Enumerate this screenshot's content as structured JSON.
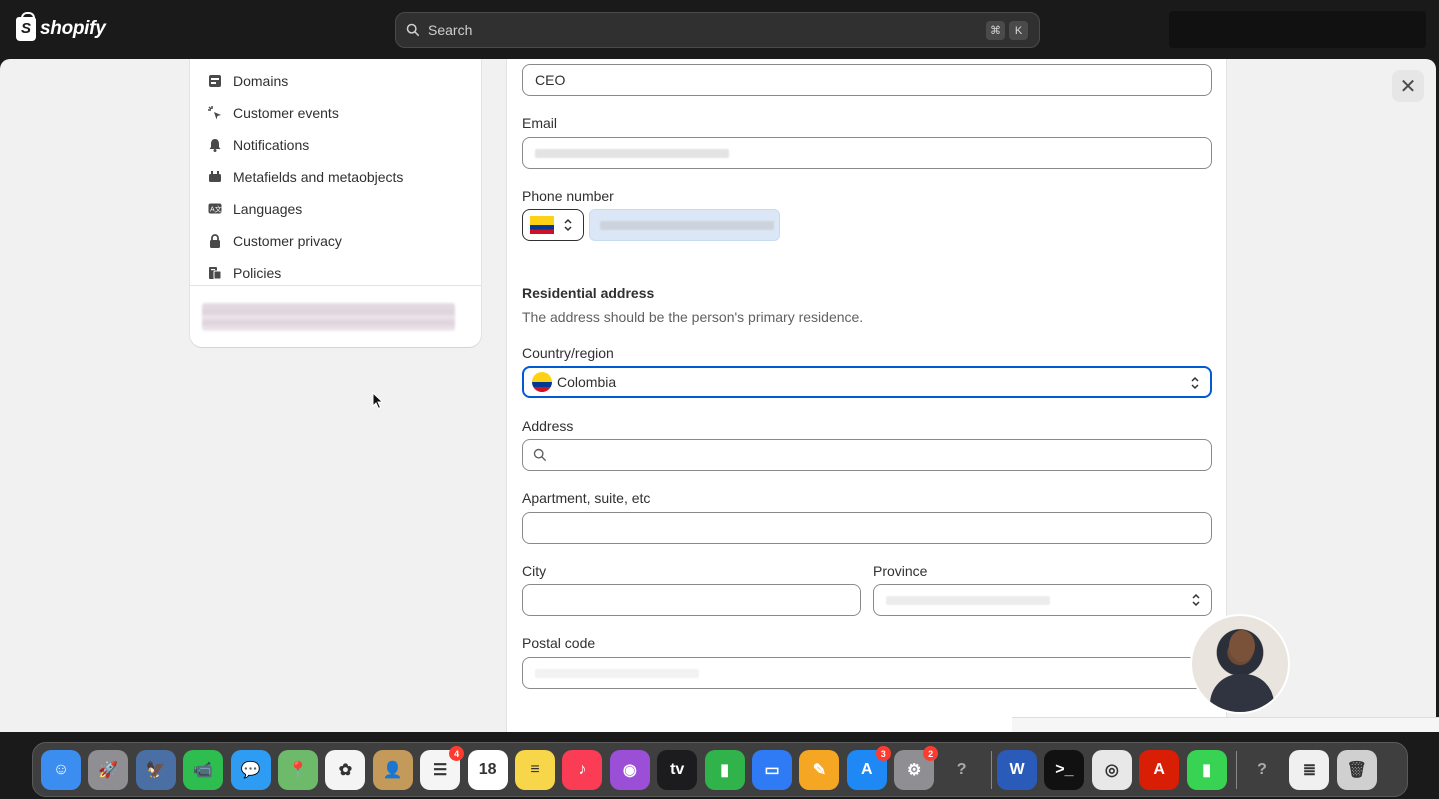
{
  "topbar": {
    "logo_text": "shopify",
    "search_placeholder": "Search",
    "shortcut_keys": [
      "⌘",
      "K"
    ]
  },
  "sidebar": {
    "items": [
      {
        "label": "Domains",
        "icon": "domains-icon"
      },
      {
        "label": "Customer events",
        "icon": "cursor-click-icon"
      },
      {
        "label": "Notifications",
        "icon": "bell-icon"
      },
      {
        "label": "Metafields and metaobjects",
        "icon": "metafields-icon"
      },
      {
        "label": "Languages",
        "icon": "language-icon"
      },
      {
        "label": "Customer privacy",
        "icon": "lock-icon"
      },
      {
        "label": "Policies",
        "icon": "policies-icon"
      }
    ]
  },
  "form": {
    "title_value": "CEO",
    "email": {
      "label": "Email",
      "value": ""
    },
    "phone": {
      "label": "Phone number",
      "country": "Colombia",
      "value": ""
    },
    "residential": {
      "title": "Residential address",
      "description": "The address should be the person's primary residence."
    },
    "country": {
      "label": "Country/region",
      "value": "Colombia"
    },
    "address": {
      "label": "Address",
      "value": ""
    },
    "apartment": {
      "label": "Apartment, suite, etc",
      "value": ""
    },
    "city": {
      "label": "City",
      "value": ""
    },
    "province": {
      "label": "Province",
      "value": ""
    },
    "postal": {
      "label": "Postal code",
      "value": ""
    }
  },
  "dock": {
    "apps": [
      {
        "name": "finder-icon",
        "color": "#3b8ef0",
        "glyph": "☺"
      },
      {
        "name": "launchpad-icon",
        "color": "#8e8e93",
        "glyph": "🚀"
      },
      {
        "name": "preview-icon",
        "color": "#4a6fa5",
        "glyph": "🦅"
      },
      {
        "name": "facetime-icon",
        "color": "#2ebd4f",
        "glyph": "📹"
      },
      {
        "name": "messages-icon",
        "color": "#2f9cf4",
        "glyph": "💬"
      },
      {
        "name": "maps-icon",
        "color": "#6dbb6a",
        "glyph": "📍"
      },
      {
        "name": "photos-icon",
        "color": "#f4f4f4",
        "glyph": "✿"
      },
      {
        "name": "contacts-icon",
        "color": "#c49a5a",
        "glyph": "👤"
      },
      {
        "name": "reminders-icon",
        "color": "#f5f5f5",
        "glyph": "☰",
        "badge": "4"
      },
      {
        "name": "calendar-icon",
        "color": "#ffffff",
        "glyph": "18"
      },
      {
        "name": "notes-icon",
        "color": "#f7d64a",
        "glyph": "≡"
      },
      {
        "name": "music-icon",
        "color": "#fa3c55",
        "glyph": "♪"
      },
      {
        "name": "podcasts-icon",
        "color": "#9b4fd6",
        "glyph": "◉"
      },
      {
        "name": "apple-tv-icon",
        "color": "#1c1c1e",
        "glyph": "tv"
      },
      {
        "name": "numbers-icon",
        "color": "#2fb34a",
        "glyph": "▮"
      },
      {
        "name": "keynote-icon",
        "color": "#2f7bf5",
        "glyph": "▭"
      },
      {
        "name": "pages-icon",
        "color": "#f5a623",
        "glyph": "✎"
      },
      {
        "name": "app-store-icon",
        "color": "#1e88f5",
        "glyph": "A",
        "badge": "3"
      },
      {
        "name": "system-settings-icon",
        "color": "#8e8e93",
        "glyph": "⚙",
        "badge": "2"
      },
      {
        "name": "unknown-app-icon",
        "color": "transparent",
        "glyph": "?"
      },
      {
        "name": "word-icon",
        "color": "#2b5bb8",
        "glyph": "W"
      },
      {
        "name": "terminal-icon",
        "color": "#111111",
        "glyph": ">_"
      },
      {
        "name": "chrome-icon",
        "color": "#e8e8e8",
        "glyph": "◎"
      },
      {
        "name": "acrobat-icon",
        "color": "#d81e05",
        "glyph": "A"
      },
      {
        "name": "green-app-icon",
        "color": "#39d353",
        "glyph": "▮"
      },
      {
        "name": "unknown-app-2-icon",
        "color": "transparent",
        "glyph": "?"
      },
      {
        "name": "documents-icon",
        "color": "#f0f0f0",
        "glyph": "≣"
      },
      {
        "name": "trash-icon",
        "color": "#d0d0d0",
        "glyph": "🗑"
      }
    ]
  }
}
